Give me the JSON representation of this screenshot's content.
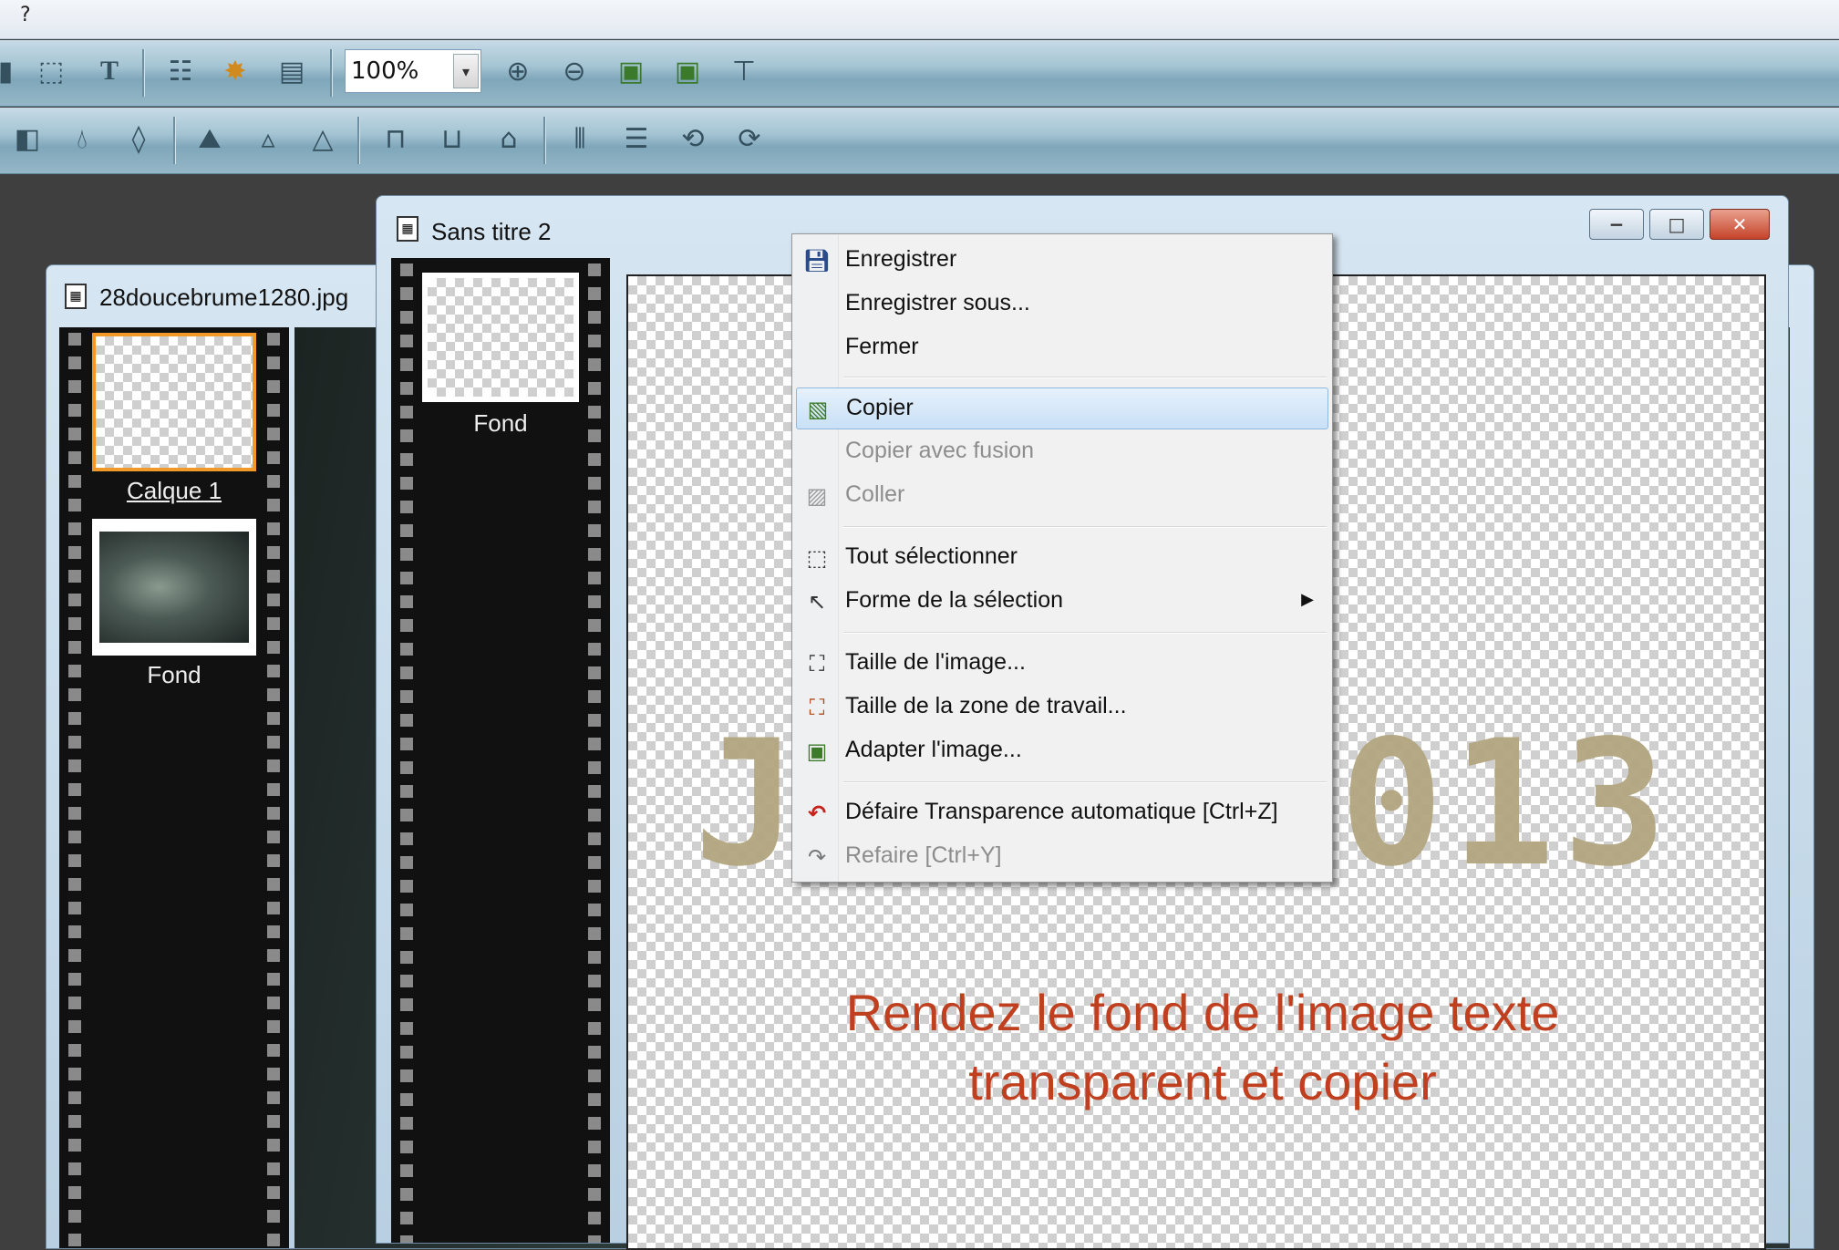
{
  "menubar": {
    "help_label": "?"
  },
  "toolbar1": {
    "zoom_value": "100%"
  },
  "window_left": {
    "title": "28doucebrume1280.jpg",
    "layers": [
      "Calque 1",
      "Fond"
    ]
  },
  "window_front": {
    "title": "Sans titre 2",
    "layers": [
      "Fond"
    ]
  },
  "canvas": {
    "big_text_left": "J",
    "big_text_right": "013",
    "instruction_line1": "Rendez le fond de l'image texte",
    "instruction_line2": "transparent et copier",
    "big_text_color": "#b3a57f",
    "instruction_color": "#bf3f1f"
  },
  "context_menu": {
    "items": [
      {
        "label": "Enregistrer",
        "icon": "save-icon",
        "enabled": true
      },
      {
        "label": "Enregistrer sous...",
        "icon": "",
        "enabled": true
      },
      {
        "label": "Fermer",
        "icon": "",
        "enabled": true
      },
      {
        "label": "Copier",
        "icon": "copy-icon",
        "enabled": true,
        "highlighted": true
      },
      {
        "label": "Copier avec fusion",
        "icon": "",
        "enabled": false
      },
      {
        "label": "Coller",
        "icon": "paste-icon",
        "enabled": false
      },
      {
        "label": "Tout sélectionner",
        "icon": "select-all-icon",
        "enabled": true
      },
      {
        "label": "Forme de la sélection",
        "icon": "pointer-icon",
        "enabled": true,
        "submenu": true
      },
      {
        "label": "Taille de l'image...",
        "icon": "image-size-icon",
        "enabled": true
      },
      {
        "label": "Taille de la zone de travail...",
        "icon": "canvas-size-icon",
        "enabled": true
      },
      {
        "label": "Adapter l'image...",
        "icon": "fit-image-icon",
        "enabled": true
      },
      {
        "label": "Défaire Transparence automatique [Ctrl+Z]",
        "icon": "undo-icon",
        "enabled": true
      },
      {
        "label": "Refaire [Ctrl+Y]",
        "icon": "redo-icon",
        "enabled": false
      }
    ]
  }
}
